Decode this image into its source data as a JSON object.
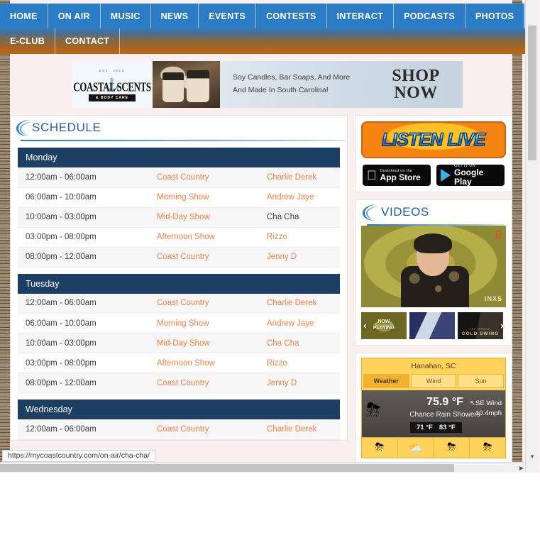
{
  "nav": {
    "row1": [
      "HOME",
      "ON AIR",
      "MUSIC",
      "NEWS",
      "EVENTS",
      "CONTESTS",
      "INTERACT",
      "PODCASTS",
      "PHOTOS"
    ],
    "row2": [
      "E-CLUB",
      "CONTACT"
    ]
  },
  "banner": {
    "brand_est": "EST. 2015",
    "brand_name": "COASTAL SCENTS",
    "brand_sub": "& BODY CARE",
    "anchor_icon": "⚓",
    "line1": "Soy Candles, Bar Soaps, And More",
    "line2": "And Made In South Carolina!",
    "cta_line1": "SHOP",
    "cta_line2": "NOW"
  },
  "schedule": {
    "header": "SCHEDULE",
    "days": [
      {
        "name": "Monday",
        "rows": [
          {
            "time": "12:00am - 06:00am",
            "show": "Coast Country",
            "host": "Charlie Derek",
            "host_hover": false
          },
          {
            "time": "06:00am - 10:00am",
            "show": "Morning Show",
            "host": "Andrew Jaye",
            "host_hover": false
          },
          {
            "time": "10:00am - 03:00pm",
            "show": "Mid-Day Show",
            "host": "Cha Cha",
            "host_hover": true
          },
          {
            "time": "03:00pm - 08:00pm",
            "show": "Afternoon Show",
            "host": "Rizzo",
            "host_hover": false
          },
          {
            "time": "08:00pm - 12:00am",
            "show": "Coast Country",
            "host": "Jenny D",
            "host_hover": false
          }
        ]
      },
      {
        "name": "Tuesday",
        "rows": [
          {
            "time": "12:00am - 06:00am",
            "show": "Coast Country",
            "host": "Charlie Derek",
            "host_hover": false
          },
          {
            "time": "06:00am - 10:00am",
            "show": "Morning Show",
            "host": "Andrew Jaye",
            "host_hover": false
          },
          {
            "time": "10:00am - 03:00pm",
            "show": "Mid-Day Show",
            "host": "Cha Cha",
            "host_hover": false
          },
          {
            "time": "03:00pm - 08:00pm",
            "show": "Afternoon Show",
            "host": "Rizzo",
            "host_hover": false
          },
          {
            "time": "08:00pm - 12:00am",
            "show": "Coast Country",
            "host": "Jenny D",
            "host_hover": false
          }
        ]
      },
      {
        "name": "Wednesday",
        "rows": [
          {
            "time": "12:00am - 06:00am",
            "show": "Coast Country",
            "host": "Charlie Derek",
            "host_hover": false
          }
        ]
      }
    ]
  },
  "sidebar": {
    "listen_live_label": "LISTEN LIVE",
    "app_store": {
      "small": "Download on the",
      "big": "App Store",
      "icon": ""
    },
    "google_play": {
      "small": "GET IT ON",
      "big": "Google Play"
    },
    "videos": {
      "header": "VIDEOS",
      "main_watermark_tr": "[]",
      "main_watermark_br": "INXS",
      "thumbs": [
        {
          "label": "NOW\nPLAYING",
          "overlay": ""
        },
        {
          "label": "",
          "overlay": ""
        },
        {
          "label": "",
          "overlay": "COLD SWING"
        }
      ],
      "prev_arrow": "‹",
      "next_arrow": "›"
    },
    "weather": {
      "city": "Hanahan, SC",
      "tabs": [
        "Weather",
        "Wind",
        "Sun"
      ],
      "active_tab": "Weather",
      "temperature": "75.9 °F",
      "condition": "Chance Rain Showers",
      "low": "71 °F",
      "high": "83 °F",
      "wind_dir": "SE Wind",
      "wind_speed": "10.4mph",
      "wind_arrow": "↖",
      "current_icon": "⛈",
      "forecast_icons": [
        "⛈",
        "⛅",
        "⛈",
        "⛈"
      ]
    }
  },
  "statusbar": {
    "url": "https://mycoastcountry.com/on-air/cha-cha/"
  },
  "scrollbars": {
    "down_arrow": "▼",
    "right_arrow": "▶"
  }
}
